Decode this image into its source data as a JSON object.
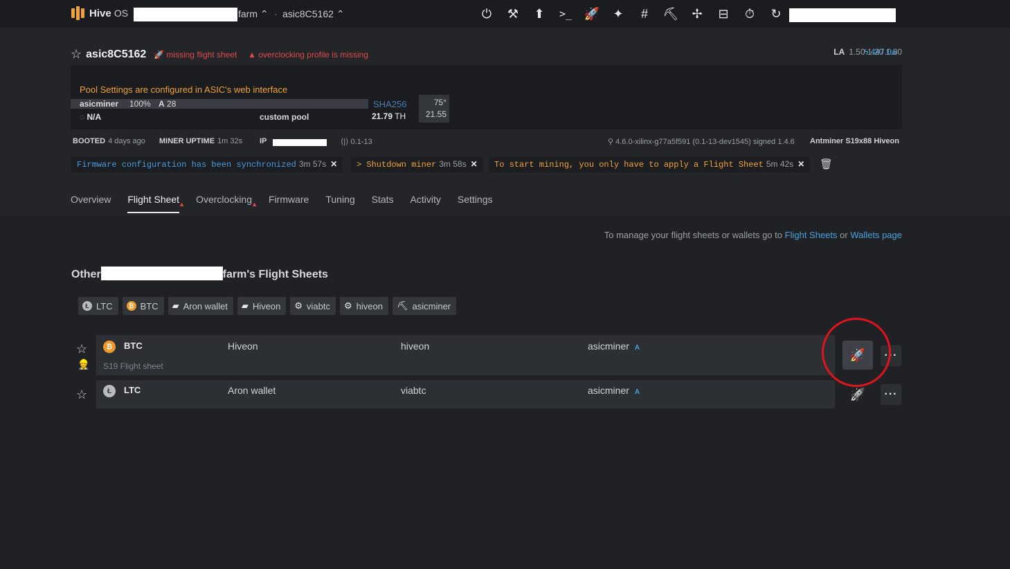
{
  "topbar": {
    "brand": "Hive",
    "brand_suffix": "OS",
    "farm_suffix": "farm ⌃",
    "separator": "·",
    "worker_crumb": "asic8C5162 ⌃",
    "icons": [
      "power-icon",
      "tools-icon",
      "upload-icon",
      "terminal-icon",
      "rocket-icon",
      "wand-icon",
      "hash-icon",
      "pickaxe-icon",
      "fan-icon",
      "minus-box-icon",
      "timer-icon",
      "refresh-icon"
    ]
  },
  "worker": {
    "name": "asic8C5162",
    "warn_flight": "missing flight sheet",
    "warn_oc": "overclocking profile is missing",
    "la_label": "LA",
    "la_values": "1.50 1.20 1.80",
    "power": "447.0",
    "power_unit": "w"
  },
  "miner": {
    "pool_note": "Pool Settings are configured in ASIC's web interface",
    "name": "asicminer",
    "percent": "100%",
    "accepted_label": "A",
    "accepted": "28",
    "algo": "SHA256",
    "hashrate": "21.79",
    "hash_unit": "TH",
    "temp": "75°",
    "fan": "21.55",
    "status": "N/A",
    "pool": "custom pool"
  },
  "info": {
    "booted_label": "BOOTED",
    "booted_value": "4 days ago",
    "uptime_label": "MINER UPTIME",
    "uptime_value": "1m 32s",
    "ip_label": "IP",
    "version": "0.1-13",
    "kernel": "4.6.0-xilinx-g77a5f591 (0.1-13-dev1545) signed 1.4.6",
    "model": "Antminer S19x88 Hiveon"
  },
  "notifications": [
    {
      "text": "Firmware configuration has been synchronized",
      "age": "3m 57s",
      "color": "#4a9be0"
    },
    {
      "text": "> Shutdown miner",
      "age": "3m 58s",
      "color": "#f0a33a"
    },
    {
      "text": "To start mining, you only have to apply a Flight Sheet",
      "age": "5m 42s",
      "color": "#f0a33a"
    }
  ],
  "tabs": [
    "Overview",
    "Flight Sheet",
    "Overclocking",
    "Firmware",
    "Tuning",
    "Stats",
    "Activity",
    "Settings"
  ],
  "manage": {
    "prefix": "To manage your flight sheets or wallets go to",
    "link1": "Flight Sheets",
    "or": "or",
    "link2": "Wallets page"
  },
  "section": {
    "prefix": "Other",
    "suffix": "farm's Flight Sheets"
  },
  "filters": [
    {
      "label": "LTC",
      "icon": "litecoin-icon"
    },
    {
      "label": "BTC",
      "icon": "bitcoin-icon"
    },
    {
      "label": "Aron wallet",
      "icon": "wallet-icon"
    },
    {
      "label": "Hiveon",
      "icon": "wallet-icon"
    },
    {
      "label": "viabtc",
      "icon": "pool-icon"
    },
    {
      "label": "hiveon",
      "icon": "pool-icon"
    },
    {
      "label": "asicminer",
      "icon": "pickaxe-icon"
    }
  ],
  "flight_sheets": [
    {
      "coin": "BTC",
      "wallet": "Hiveon",
      "pool": "hiveon",
      "miner": "asicminer",
      "miner_badge": "A",
      "name": "S19 Flight sheet"
    },
    {
      "coin": "LTC",
      "wallet": "Aron wallet",
      "pool": "viabtc",
      "miner": "asicminer",
      "miner_badge": "A",
      "name": ""
    }
  ],
  "colors": {
    "accent": "#4aa3df",
    "warning": "#e04b4b",
    "orange": "#f0a33a",
    "highlight_circle": "#e0141c"
  }
}
